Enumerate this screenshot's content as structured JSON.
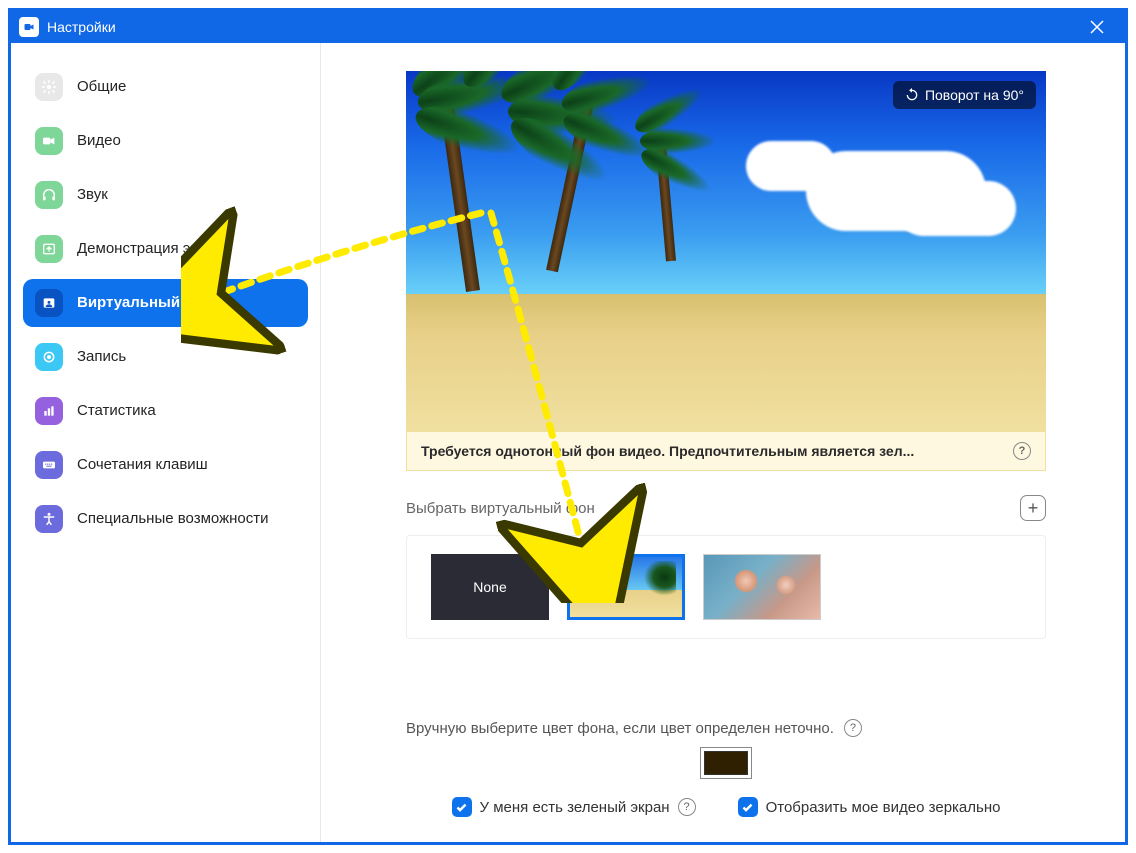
{
  "titlebar": {
    "title": "Настройки"
  },
  "sidebar": {
    "items": [
      {
        "label": "Общие"
      },
      {
        "label": "Видео"
      },
      {
        "label": "Звук"
      },
      {
        "label": "Демонстрация экрана"
      },
      {
        "label": "Виртуальный фон"
      },
      {
        "label": "Запись"
      },
      {
        "label": "Статистика"
      },
      {
        "label": "Сочетания клавиш"
      },
      {
        "label": "Специальные возможности"
      }
    ]
  },
  "preview": {
    "rotate_label": "Поворот на 90°",
    "warning_text": "Требуется однотонный фон видео. Предпочтительным является зел..."
  },
  "section": {
    "choose_label": "Выбрать виртуальный фон",
    "none_label": "None"
  },
  "manual": {
    "label": "Вручную выберите цвет фона, если цвет определен неточно.",
    "selected_color": "#2E2000"
  },
  "checks": {
    "green_screen": "У меня есть зеленый экран",
    "mirror": "Отобразить мое видео зеркально"
  }
}
